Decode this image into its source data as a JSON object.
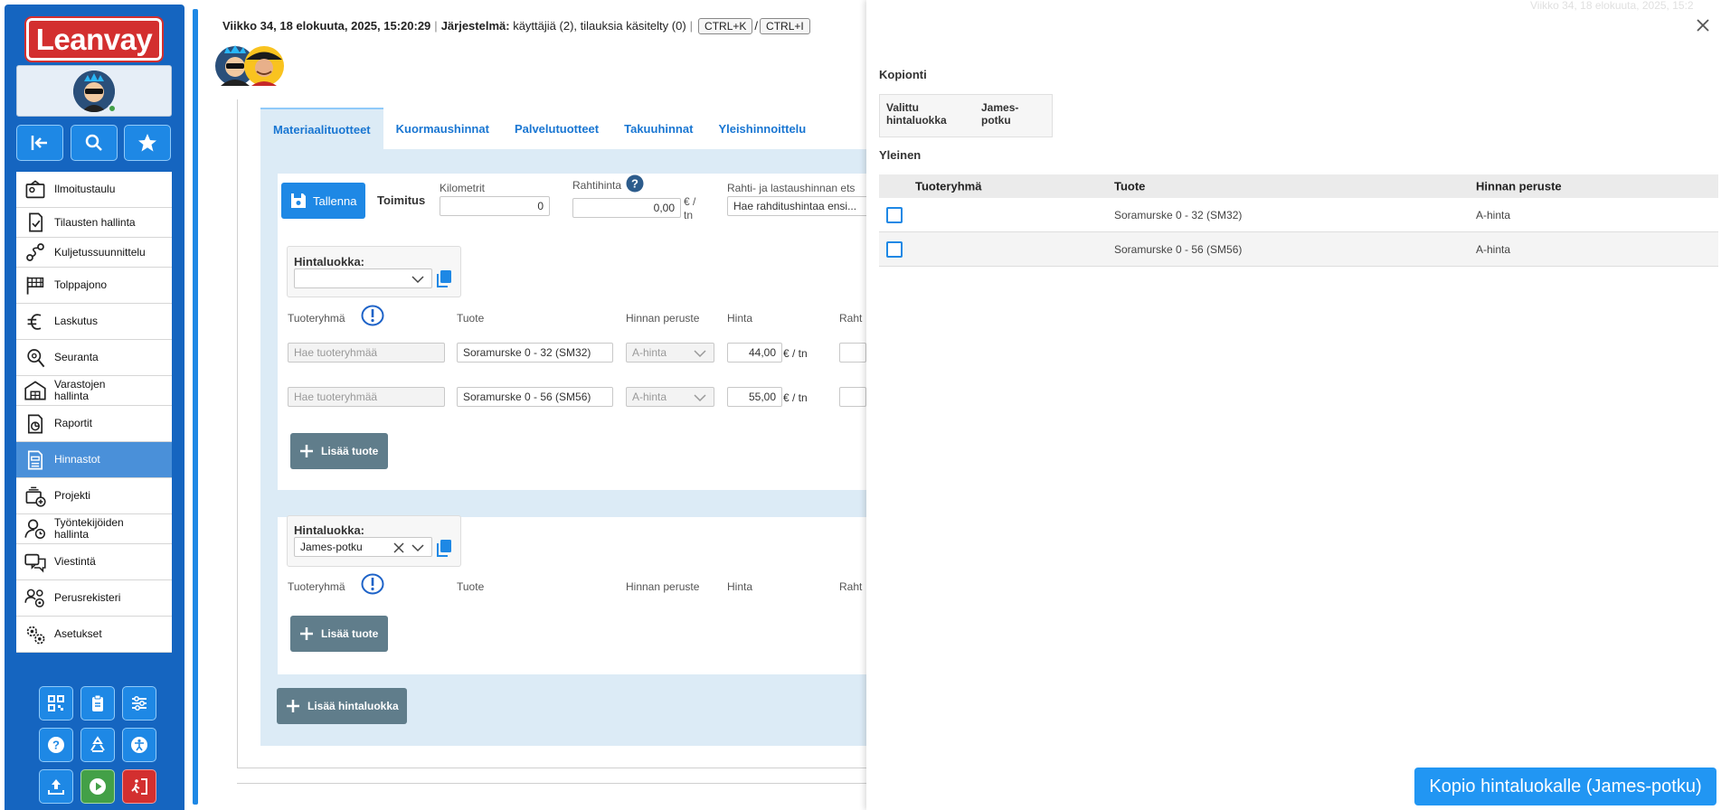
{
  "header": {
    "datetime": "Viikko 34, 18 elokuuta, 2025, 15:20:29",
    "system_label": "Järjestelmä:",
    "system_status": "käyttäjiä (2), tilauksia käsitelty (0)",
    "shortcut_k": "CTRL+K",
    "shortcut_slash": "/",
    "shortcut_i": "CTRL+I",
    "ghost_datetime": "Viikko 34, 18 elokuuta, 2025, 15:2"
  },
  "sidebar": {
    "logo": "Leanvay",
    "menu": [
      {
        "label": "Ilmoitustaulu",
        "icon": "notice-board-icon"
      },
      {
        "label": "Tilausten hallinta",
        "icon": "order-check-icon"
      },
      {
        "label": "Kuljetussuunnittelu",
        "icon": "route-icon"
      },
      {
        "label": "Tolppajono",
        "icon": "flag-icon"
      },
      {
        "label": "Laskutus",
        "icon": "euro-icon"
      },
      {
        "label": "Seuranta",
        "icon": "location-search-icon"
      },
      {
        "label": "Varastojen hallinta",
        "icon": "warehouse-icon"
      },
      {
        "label": "Raportit",
        "icon": "report-icon"
      },
      {
        "label": "Hinnastot",
        "icon": "price-list-icon"
      },
      {
        "label": "Projekti",
        "icon": "project-icon"
      },
      {
        "label": "Työntekijöiden hallinta",
        "icon": "employee-clock-icon"
      },
      {
        "label": "Viestintä",
        "icon": "chat-icon"
      },
      {
        "label": "Perusrekisteri",
        "icon": "users-gear-icon"
      },
      {
        "label": "Asetukset",
        "icon": "settings-icon"
      }
    ],
    "active_index": 8
  },
  "tabs": [
    "Materiaalituotteet",
    "Kuormaushinnat",
    "Palvelutuotteet",
    "Takuuhinnat",
    "Yleishinnoittelu"
  ],
  "form": {
    "save_label": "Tallenna",
    "toimitus_label": "Toimitus",
    "kilometrit_label": "Kilometrit",
    "kilometrit_value": "0",
    "rahtihinta_label": "Rahtihinta",
    "rahtihinta_value": "0,00",
    "rahtihinta_unit": "€ / tn",
    "rahti_lastaus_label": "Rahti- ja lastaushinnan ets",
    "rahti_lastaus_placeholder": "Hae rahditushintaa ensi..."
  },
  "price_groups": [
    {
      "label": "Hintaluokka:",
      "selected": "",
      "columns": [
        "Tuoteryhmä",
        "Tuote",
        "Hinnan peruste",
        "Hinta",
        "Raht"
      ],
      "rows": [
        {
          "group_placeholder": "Hae tuoteryhmää",
          "product": "Soramurske 0 - 32 (SM32)",
          "basis": "A-hinta",
          "price": "44,00",
          "unit": "€ / tn"
        },
        {
          "group_placeholder": "Hae tuoteryhmää",
          "product": "Soramurske 0 - 56 (SM56)",
          "basis": "A-hinta",
          "price": "55,00",
          "unit": "€ / tn"
        }
      ],
      "add_label": "Lisää tuote"
    },
    {
      "label": "Hintaluokka:",
      "selected": "James-potku",
      "columns": [
        "Tuoteryhmä",
        "Tuote",
        "Hinnan peruste",
        "Hinta",
        "Raht"
      ],
      "rows": [],
      "add_label": "Lisää tuote"
    }
  ],
  "add_price_group_label": "Lisää hintaluokka",
  "modal": {
    "copy_section": "Kopionti",
    "copy_table": {
      "col1": "Valittu hintaluokka",
      "col2": "James-potku"
    },
    "general_section": "Yleinen",
    "columns": [
      "Tuoteryhmä",
      "Tuote",
      "Hinnan peruste"
    ],
    "rows": [
      {
        "group": "",
        "product": "Soramurske 0 - 32 (SM32)",
        "basis": "A-hinta"
      },
      {
        "group": "",
        "product": "Soramurske 0 - 56 (SM56)",
        "basis": "A-hinta"
      }
    ],
    "copy_button": "Kopio hintaluokalle (James-potku)"
  },
  "colors": {
    "sidebar_blue": "#1565c0",
    "accent_blue": "#1e88e5",
    "logo_red": "#d32f2f",
    "tab_area": "#dcebf6",
    "slate": "#607d8b"
  }
}
